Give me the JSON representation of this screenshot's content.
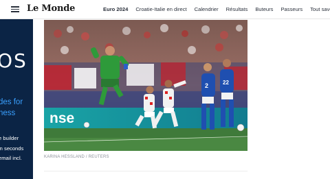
{
  "header": {
    "logo": "Le Monde",
    "nav": [
      {
        "label": "Euro 2024",
        "strong": true
      },
      {
        "label": "Croatie-Italie en direct"
      },
      {
        "label": "Calendrier"
      },
      {
        "label": "Résultats"
      },
      {
        "label": "Buteurs"
      },
      {
        "label": "Passeurs"
      },
      {
        "label": "Tout savoir"
      }
    ]
  },
  "ad": {
    "big": "OS",
    "blue_lines": [
      "des for",
      "ness"
    ],
    "small_lines": [
      "e builder",
      "in seconds",
      "email incl."
    ]
  },
  "photo": {
    "scoreboard": "nse"
  },
  "caption": {
    "credit": "KARINA HESSLAND / REUTERS"
  }
}
